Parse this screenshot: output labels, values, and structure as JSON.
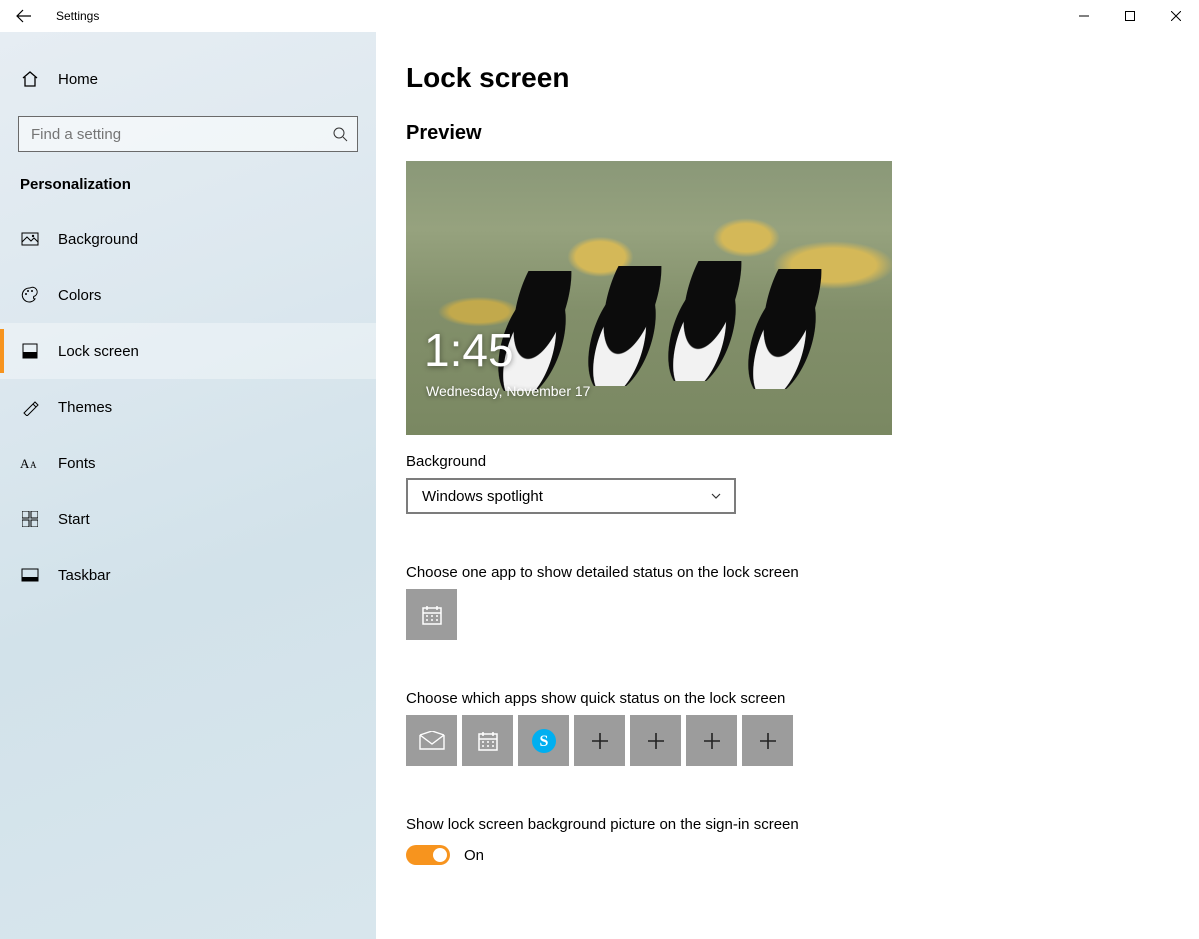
{
  "window": {
    "title": "Settings"
  },
  "sidebar": {
    "home": "Home",
    "search_placeholder": "Find a setting",
    "group": "Personalization",
    "items": [
      {
        "label": "Background",
        "icon": "background"
      },
      {
        "label": "Colors",
        "icon": "colors"
      },
      {
        "label": "Lock screen",
        "icon": "lockscreen",
        "active": true
      },
      {
        "label": "Themes",
        "icon": "themes"
      },
      {
        "label": "Fonts",
        "icon": "fonts"
      },
      {
        "label": "Start",
        "icon": "start"
      },
      {
        "label": "Taskbar",
        "icon": "taskbar"
      }
    ]
  },
  "page": {
    "title": "Lock screen",
    "preview_heading": "Preview",
    "preview": {
      "time": "1:45",
      "date": "Wednesday, November 17"
    },
    "background_label": "Background",
    "background_value": "Windows spotlight",
    "detailed_label": "Choose one app to show detailed status on the lock screen",
    "detailed_apps": [
      {
        "icon": "calendar"
      }
    ],
    "quick_label": "Choose which apps show quick status on the lock screen",
    "quick_apps": [
      {
        "icon": "mail"
      },
      {
        "icon": "calendar"
      },
      {
        "icon": "skype"
      },
      {
        "icon": "add"
      },
      {
        "icon": "add"
      },
      {
        "icon": "add"
      },
      {
        "icon": "add"
      }
    ],
    "signin_bg_label": "Show lock screen background picture on the sign-in screen",
    "signin_bg_toggle": {
      "on": true,
      "text": "On"
    }
  }
}
